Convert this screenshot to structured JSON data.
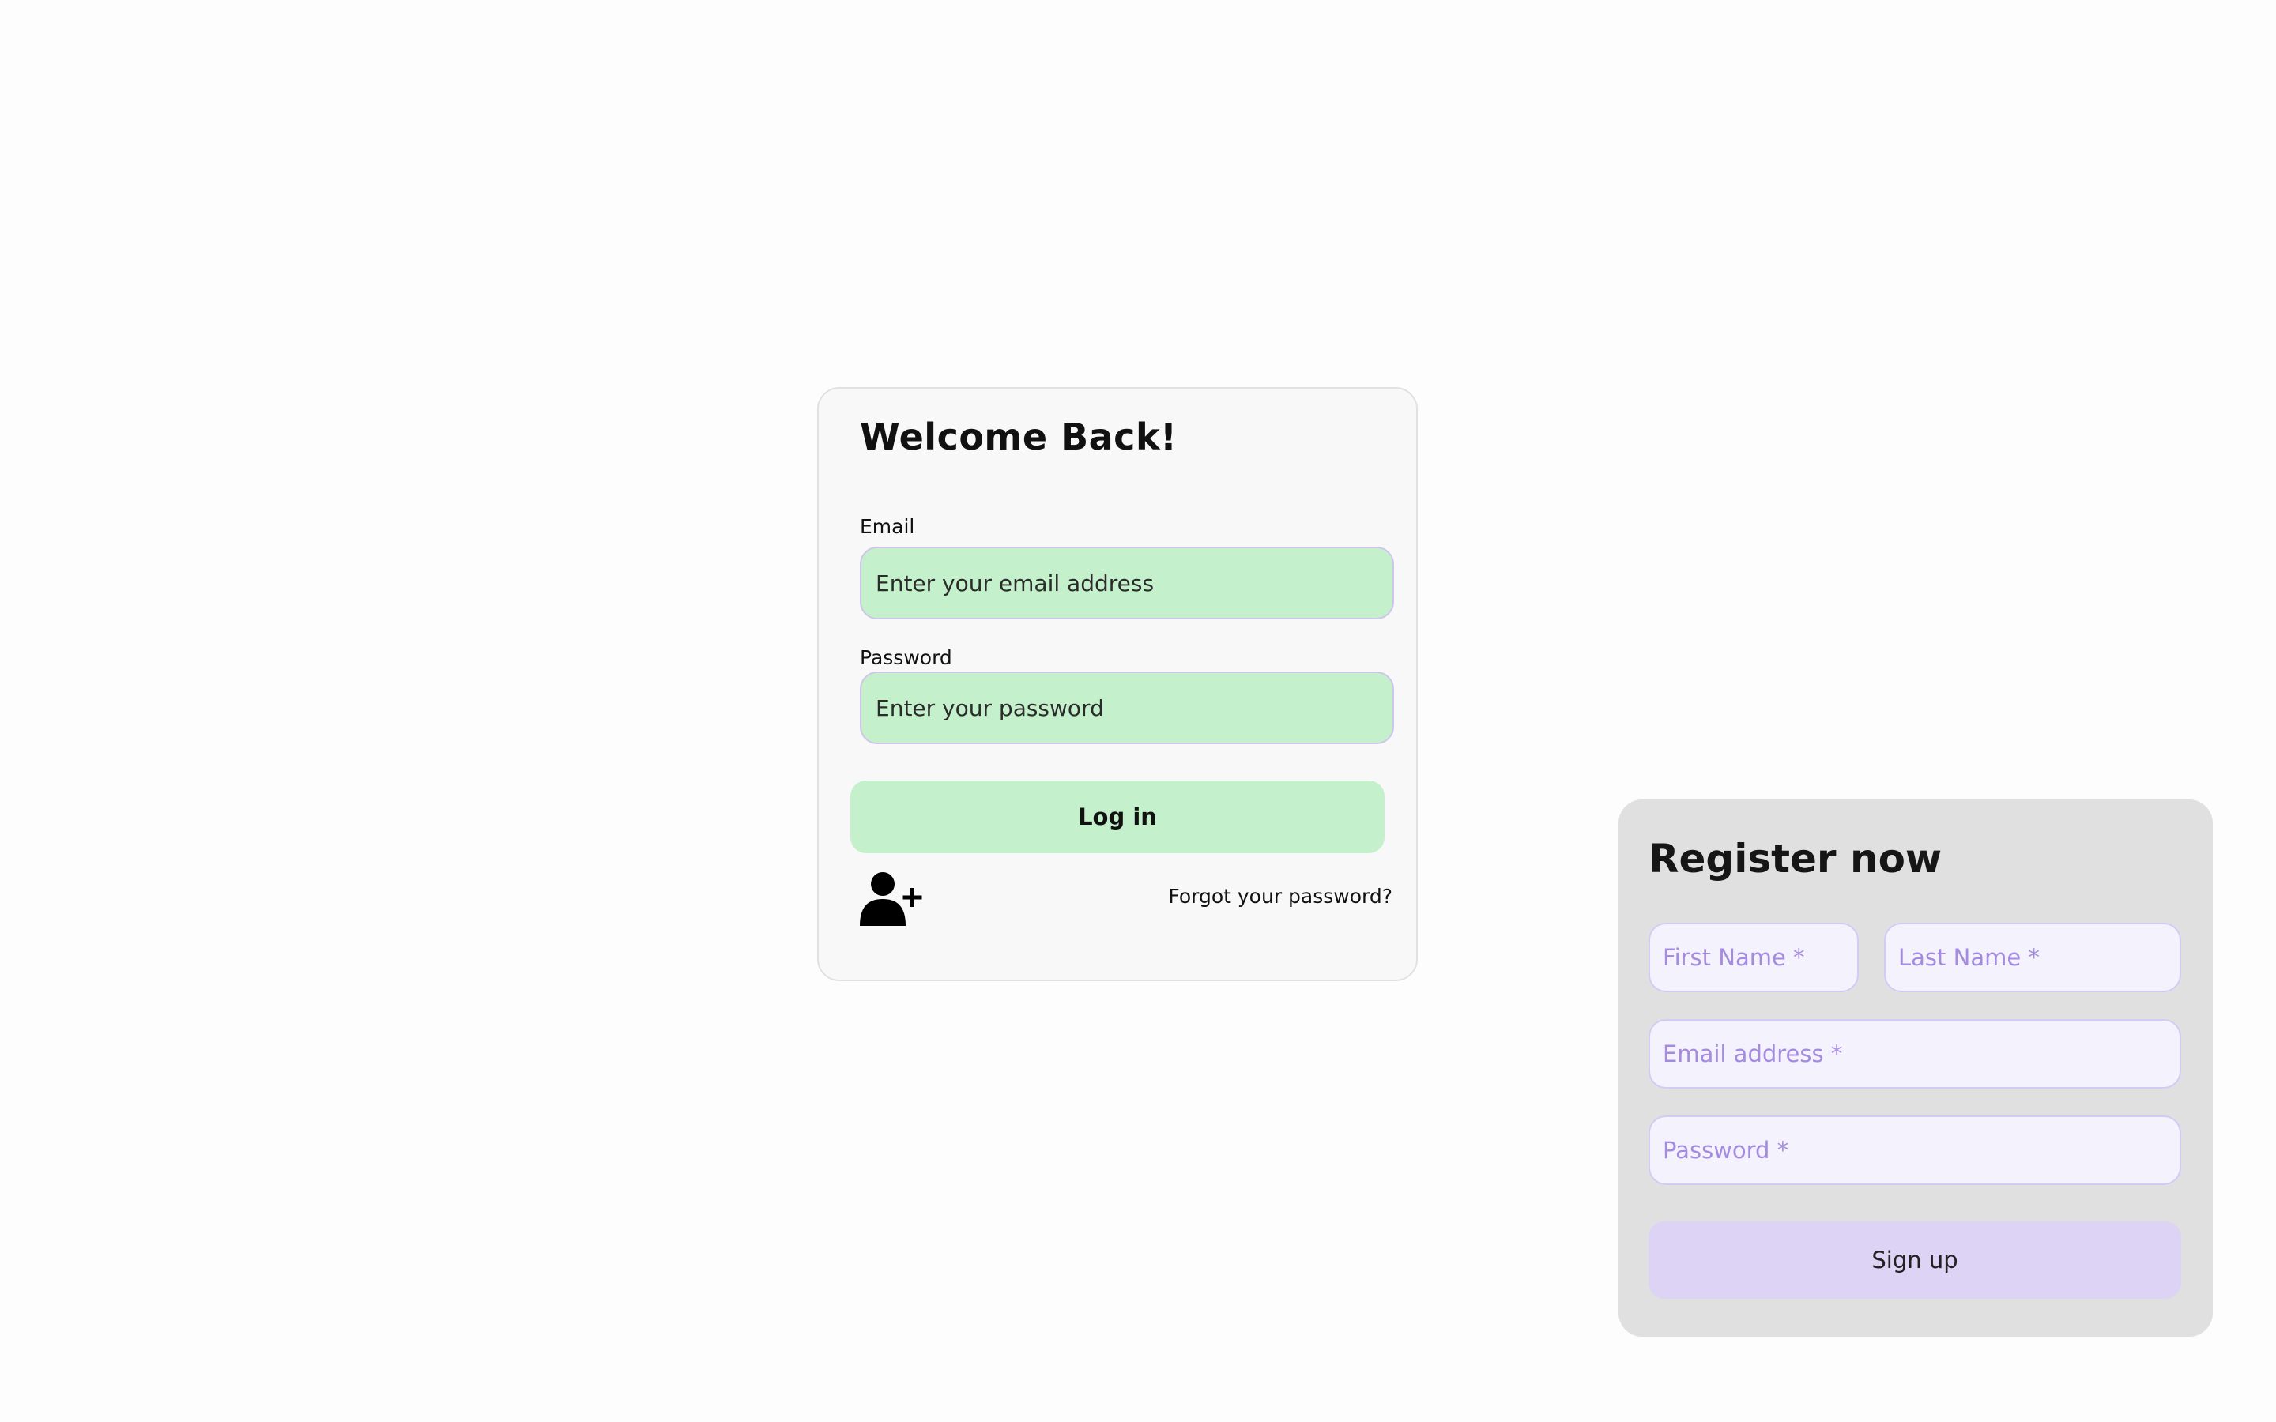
{
  "login": {
    "title": "Welcome Back!",
    "email_label": "Email",
    "email_placeholder": "Enter your email address",
    "password_label": "Password",
    "password_placeholder": "Enter your password",
    "login_button": "Log in",
    "register_icon": "user-plus-icon",
    "forgot_link": "Forgot your password?"
  },
  "register": {
    "title": "Register now",
    "first_name_placeholder": "First Name *",
    "last_name_placeholder": "Last Name *",
    "email_placeholder": "Email address *",
    "password_placeholder": "Password *",
    "signup_button": "Sign up"
  },
  "colors": {
    "login_accent": "#c4f1cb",
    "register_accent": "#dcd3f5",
    "placeholder_purple": "#a58be0"
  }
}
